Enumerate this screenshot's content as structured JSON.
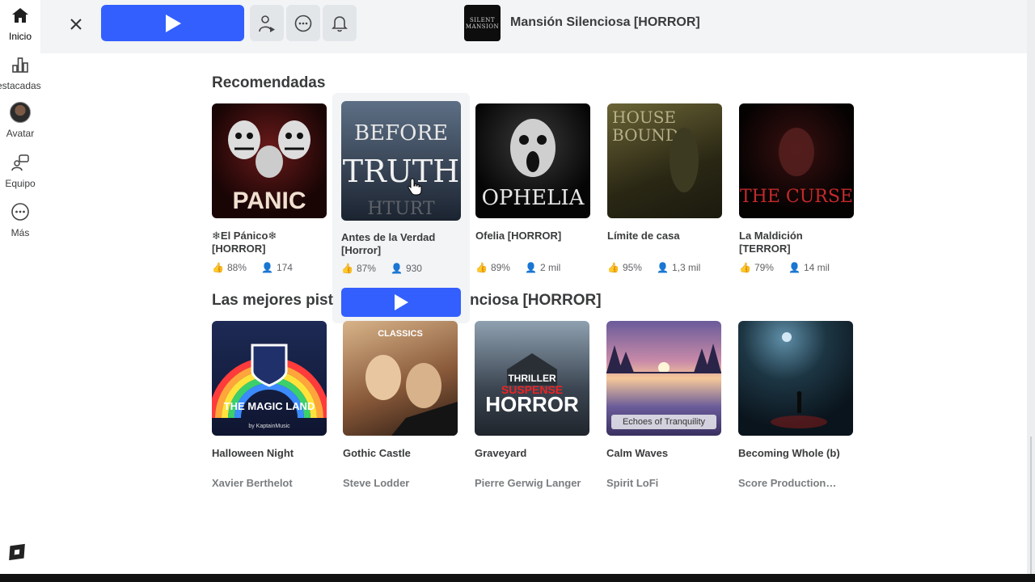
{
  "nav": {
    "items": [
      {
        "label": "Inicio",
        "icon": "home-icon"
      },
      {
        "label": "Destacadas",
        "icon": "chart-icon"
      },
      {
        "label": "Avatar",
        "icon": "avatar-icon"
      },
      {
        "label": "Equipo",
        "icon": "team-icon"
      },
      {
        "label": "Más",
        "icon": "more-icon"
      }
    ]
  },
  "header": {
    "game_title": "Mansión Silenciosa [HORROR]",
    "thumb_text_1": "SILENT",
    "thumb_text_2": "MANSION"
  },
  "recommended": {
    "title": "Recomendadas",
    "games": [
      {
        "name": "❄El Pánico❄ [HORROR]",
        "likes": "88%",
        "players": "174",
        "art": "THE PANIC"
      },
      {
        "name": "Antes de la Verdad [Horror]",
        "likes": "87%",
        "players": "930",
        "art": "BEFORE TRUTH"
      },
      {
        "name": "Ofelia [HORROR]",
        "likes": "89%",
        "players": "2 mil",
        "art": "OPHELIA"
      },
      {
        "name": "Límite de casa",
        "likes": "95%",
        "players": "1,3 mil",
        "art": "HOUSE BOUND"
      },
      {
        "name": "La Maldición [TERROR]",
        "likes": "79%",
        "players": "14 mil",
        "art": "THE CURSE"
      }
    ]
  },
  "tracks": {
    "title": "Las mejores pistas de Mansión Silenciosa [HORROR]",
    "visible_title_left": "Las mejores pist",
    "visible_title_right": "nciosa [HORROR]",
    "items": [
      {
        "name": "Halloween Night",
        "artist": "Xavier Berthelot",
        "art": "THE MAGIC LAND",
        "art_sub": "by KaptainMusic"
      },
      {
        "name": "Gothic Castle",
        "artist": "Steve Lodder",
        "art": "CLASSICS"
      },
      {
        "name": "Graveyard",
        "artist": "Pierre Gerwig Langer",
        "art": "THRILLER SUSPENSE HORROR"
      },
      {
        "name": "Calm Waves",
        "artist": "Spirit LoFi",
        "art": "Echoes of Tranquility"
      },
      {
        "name": "Becoming Whole (b)",
        "artist": "Score Production…"
      }
    ]
  },
  "colors": {
    "accent": "#335fff",
    "header_bg": "#f2f4f5"
  }
}
